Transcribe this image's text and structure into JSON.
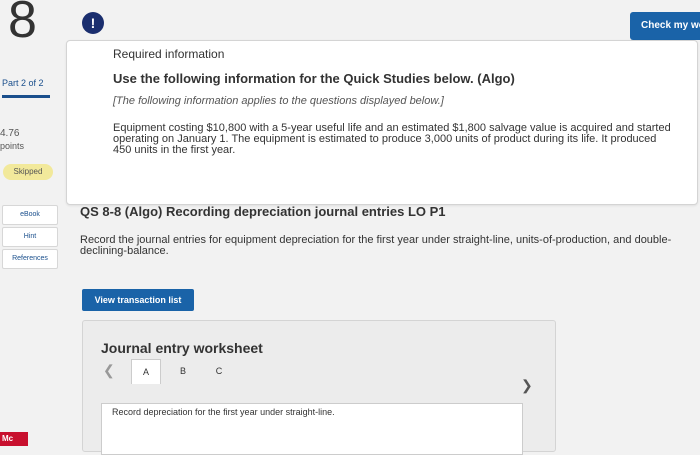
{
  "sidebar": {
    "question_number": "8",
    "part": "Part 2 of 2",
    "points_value": "4.76",
    "points_label": "points",
    "status": "Skipped",
    "buttons": [
      "eBook",
      "Hint",
      "References"
    ],
    "logo": "Mc"
  },
  "header": {
    "alert_symbol": "!",
    "check_button": "Check my wo"
  },
  "info": {
    "required_title": "Required information",
    "use_title": "Use the following information for the Quick Studies below. (Algo)",
    "note": "[The following information applies to the questions displayed below.]",
    "body": "Equipment costing $10,800 with a 5-year useful life and an estimated $1,800 salvage value is acquired and started operating on January 1. The equipment is estimated to produce 3,000 units of product during its life. It produced 450 units in the first year."
  },
  "question": {
    "title": "QS 8-8 (Algo) Recording depreciation journal entries LO P1",
    "text": "Record the journal entries for equipment depreciation for the first year under straight-line, units-of-production, and double-declining-balance.",
    "view_button": "View transaction list"
  },
  "worksheet": {
    "title": "Journal entry worksheet",
    "tabs": [
      "A",
      "B",
      "C"
    ],
    "active_tab": "A",
    "instruction": "Record depreciation for the first year under straight-line."
  },
  "colors": {
    "brand_blue": "#1a63a8",
    "alert_navy": "#1a2e6e",
    "skipped_yellow": "#f2e99b",
    "logo_red": "#c8102e"
  }
}
